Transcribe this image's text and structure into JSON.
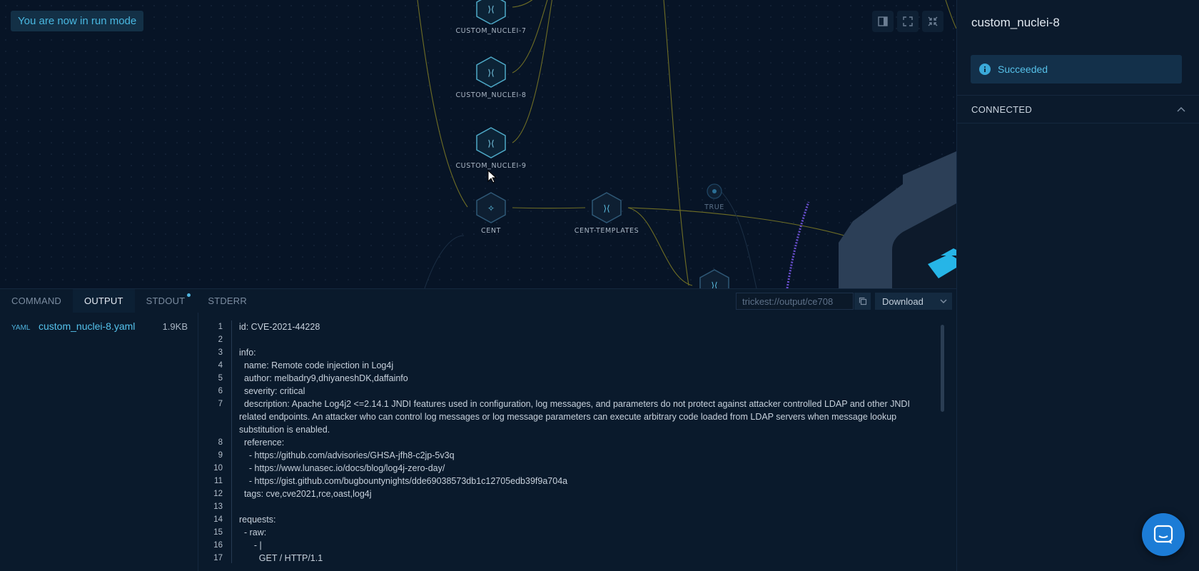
{
  "canvas": {
    "run_mode_text": "You are now in run mode",
    "controls": [
      {
        "icon": "panel-toggle-icon"
      },
      {
        "icon": "fullscreen-icon"
      },
      {
        "icon": "collapse-icon"
      }
    ],
    "nodes": {
      "n7": "CUSTOM_NUCLEI-7",
      "n8": "CUSTOM_NUCLEI-8",
      "n9": "CUSTOM_NUCLEI-9",
      "cent": "CENT",
      "cent_templates": "CENT-TEMPLATES",
      "true_node": "TRUE"
    }
  },
  "right_panel": {
    "title": "custom_nuclei-8",
    "status": "Succeeded",
    "connected_label": "CONNECTED"
  },
  "bottom_panel": {
    "tabs": [
      {
        "label": "COMMAND",
        "active": false
      },
      {
        "label": "OUTPUT",
        "active": true
      },
      {
        "label": "STDOUT",
        "active": false,
        "dot": true
      },
      {
        "label": "STDERR",
        "active": false
      }
    ],
    "output_path": "trickest://output/ce708",
    "download_label": "Download",
    "file": {
      "type": "YAML",
      "name": "custom_nuclei-8.yaml",
      "size": "1.9KB"
    },
    "code_lines": [
      {
        "n": "1",
        "text": "id: CVE-2021-44228"
      },
      {
        "n": "2",
        "text": ""
      },
      {
        "n": "3",
        "text": "info:"
      },
      {
        "n": "4",
        "text": "  name: Remote code injection in Log4j"
      },
      {
        "n": "5",
        "text": "  author: melbadry9,dhiyaneshDK,daffainfo"
      },
      {
        "n": "6",
        "text": "  severity: critical"
      },
      {
        "n": "7",
        "text": "  description: Apache Log4j2 <=2.14.1 JNDI features used in configuration, log messages, and parameters do not protect against attacker controlled LDAP and other JNDI related endpoints. An attacker who can control log messages or log message parameters can execute arbitrary code loaded from LDAP servers when message lookup substitution is enabled."
      },
      {
        "n": "8",
        "text": "  reference:"
      },
      {
        "n": "9",
        "text": "    - https://github.com/advisories/GHSA-jfh8-c2jp-5v3q"
      },
      {
        "n": "10",
        "text": "    - https://www.lunasec.io/docs/blog/log4j-zero-day/"
      },
      {
        "n": "11",
        "text": "    - https://gist.github.com/bugbountynights/dde69038573db1c12705edb39f9a704a"
      },
      {
        "n": "12",
        "text": "  tags: cve,cve2021,rce,oast,log4j"
      },
      {
        "n": "13",
        "text": ""
      },
      {
        "n": "14",
        "text": "requests:"
      },
      {
        "n": "15",
        "text": "  - raw:"
      },
      {
        "n": "16",
        "text": "      - |"
      },
      {
        "n": "17",
        "text": "        GET / HTTP/1.1"
      }
    ]
  },
  "colors": {
    "accent": "#49b7e0",
    "background": "#071528",
    "panel": "#0b1a2c",
    "edge": "#7b7a2a"
  }
}
